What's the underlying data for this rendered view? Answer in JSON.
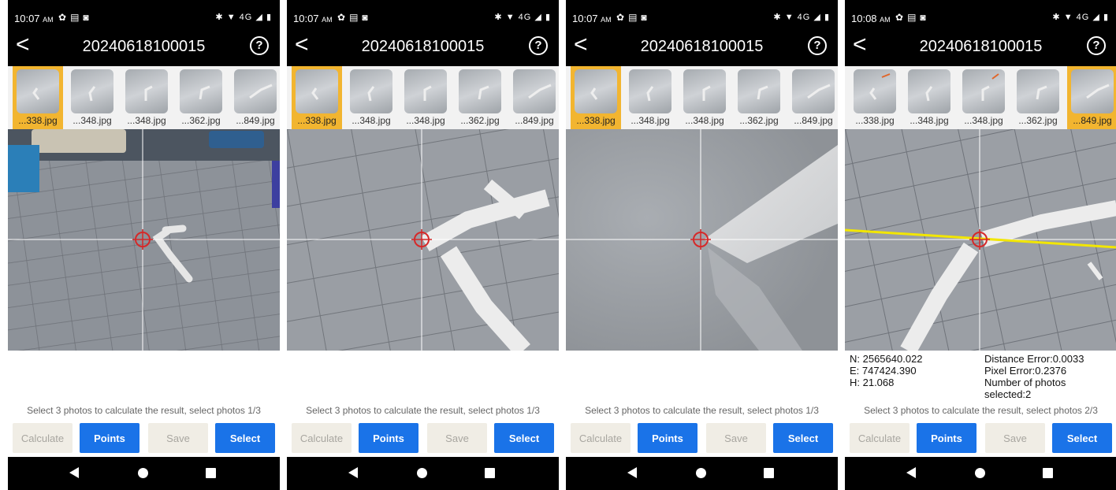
{
  "colors": {
    "selected_thumb": "#f2b530",
    "primary_button": "#1a73e8",
    "disabled_button": "#f0ede5",
    "crosshair_marker": "#d62828",
    "epipolar_line": "#f2e600"
  },
  "icons": {
    "back": "chevron-left-icon",
    "help": "question-circle-icon",
    "status": [
      "settings-gear-icon",
      "message-icon",
      "image-icon",
      "bluetooth-icon",
      "wifi-icon",
      "signal-icon",
      "battery-icon"
    ],
    "nav": [
      "nav-back-icon",
      "nav-home-icon",
      "nav-recent-icon"
    ]
  },
  "screens": [
    {
      "time": "10:07",
      "ampm": "AM",
      "title": "20240618100015",
      "help_label": "?",
      "back_label": "<",
      "network": "4G",
      "thumbs": [
        {
          "label": "...338.jpg",
          "selected": true
        },
        {
          "label": "...348.jpg",
          "selected": false
        },
        {
          "label": "...348.jpg",
          "selected": false
        },
        {
          "label": "...362.jpg",
          "selected": false
        },
        {
          "label": "...849.jpg",
          "selected": false
        }
      ],
      "hint": "Select 3 photos to calculate the result, select photos 1/3",
      "buttons": {
        "calculate": "Calculate",
        "points": "Points",
        "save": "Save",
        "select": "Select"
      }
    },
    {
      "time": "10:07",
      "ampm": "AM",
      "title": "20240618100015",
      "help_label": "?",
      "back_label": "<",
      "network": "4G",
      "thumbs": [
        {
          "label": "...338.jpg",
          "selected": true
        },
        {
          "label": "...348.jpg",
          "selected": false
        },
        {
          "label": "...348.jpg",
          "selected": false
        },
        {
          "label": "...362.jpg",
          "selected": false
        },
        {
          "label": "...849.jpg",
          "selected": false
        }
      ],
      "hint": "Select 3 photos to calculate the result, select photos 1/3",
      "buttons": {
        "calculate": "Calculate",
        "points": "Points",
        "save": "Save",
        "select": "Select"
      }
    },
    {
      "time": "10:07",
      "ampm": "AM",
      "title": "20240618100015",
      "help_label": "?",
      "back_label": "<",
      "network": "4G",
      "thumbs": [
        {
          "label": "...338.jpg",
          "selected": true
        },
        {
          "label": "...348.jpg",
          "selected": false
        },
        {
          "label": "...348.jpg",
          "selected": false
        },
        {
          "label": "...362.jpg",
          "selected": false
        },
        {
          "label": "...849.jpg",
          "selected": false
        }
      ],
      "hint": "Select 3 photos to calculate the result, select photos 1/3",
      "buttons": {
        "calculate": "Calculate",
        "points": "Points",
        "save": "Save",
        "select": "Select"
      }
    },
    {
      "time": "10:08",
      "ampm": "AM",
      "title": "20240618100015",
      "help_label": "?",
      "back_label": "<",
      "network": "4G",
      "thumbs": [
        {
          "label": "...338.jpg",
          "selected": false
        },
        {
          "label": "...348.jpg",
          "selected": false
        },
        {
          "label": "...348.jpg",
          "selected": false
        },
        {
          "label": "...362.jpg",
          "selected": false
        },
        {
          "label": "...849.jpg",
          "selected": true
        }
      ],
      "results": {
        "n": "N: 2565640.022",
        "e": "E: 747424.390",
        "h": "H: 21.068",
        "distance_error": "Distance Error:0.0033",
        "pixel_error": "Pixel Error:0.2376",
        "num_photos": "Number of photos selected:2"
      },
      "hint": "Select 3 photos to calculate the result, select photos 2/3",
      "buttons": {
        "calculate": "Calculate",
        "points": "Points",
        "save": "Save",
        "select": "Select"
      }
    }
  ]
}
